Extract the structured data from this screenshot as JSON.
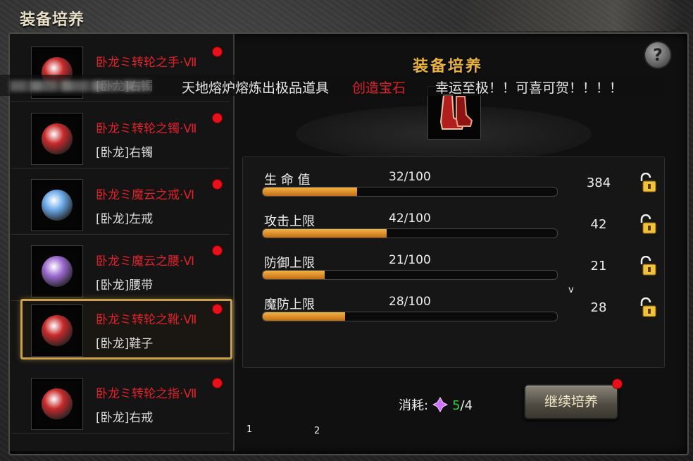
{
  "window": {
    "title": "装备培养"
  },
  "panel": {
    "title": "装备培养",
    "help_label": "?"
  },
  "marquee": {
    "text_white_1": "天地熔炉熔炼出极品道具",
    "text_red": "创造宝石",
    "text_white_2": "幸运至极！！可喜可贺！！！！"
  },
  "equipment": [
    {
      "name": "卧龙ミ转轮之手·Ⅶ",
      "type": "[卧龙]右镯",
      "gem_color": "#c72a2a"
    },
    {
      "name": "卧龙ミ转轮之镯·Ⅶ",
      "type": "[卧龙]右镯",
      "gem_color": "#c72a2a"
    },
    {
      "name": "卧龙ミ魔云之戒·Ⅵ",
      "type": "[卧龙]左戒",
      "gem_color": "#6aa8e8"
    },
    {
      "name": "卧龙ミ魔云之腰·Ⅵ",
      "type": "[卧龙]腰带",
      "gem_color": "#9b6ad0"
    },
    {
      "name": "卧龙ミ转轮之靴·Ⅶ",
      "type": "[卧龙]鞋子",
      "gem_color": "#c72a2a"
    },
    {
      "name": "卧龙ミ转轮之指·Ⅶ",
      "type": "[卧龙]右戒",
      "gem_color": "#c72a2a"
    }
  ],
  "selected_index": 4,
  "stats": [
    {
      "label": "生 命 值",
      "value_text": "32/100",
      "progress": 0.32,
      "bonus": "384"
    },
    {
      "label": "攻击上限",
      "value_text": "42/100",
      "progress": 0.42,
      "bonus": "42"
    },
    {
      "label": "防御上限",
      "value_text": "21/100",
      "progress": 0.21,
      "bonus": "21"
    },
    {
      "label": "魔防上限",
      "value_text": "28/100",
      "progress": 0.28,
      "bonus": "28"
    }
  ],
  "stray": {
    "v": "v",
    "one": "1",
    "two": "2"
  },
  "cost": {
    "label": "消耗:",
    "have": "5",
    "need": "/4"
  },
  "continue_button": {
    "label": "继续培养"
  },
  "colors": {
    "accent_gold": "#caa14a",
    "item_name_red": "#e0202a",
    "bar_orange": "#e69a2e",
    "have_green": "#2fcf3a",
    "notice_red": "#e8101a"
  },
  "icons": {
    "help": "question-icon",
    "lock": "lock-icon",
    "cost": "crystal-icon",
    "notification": "red-dot-icon"
  }
}
